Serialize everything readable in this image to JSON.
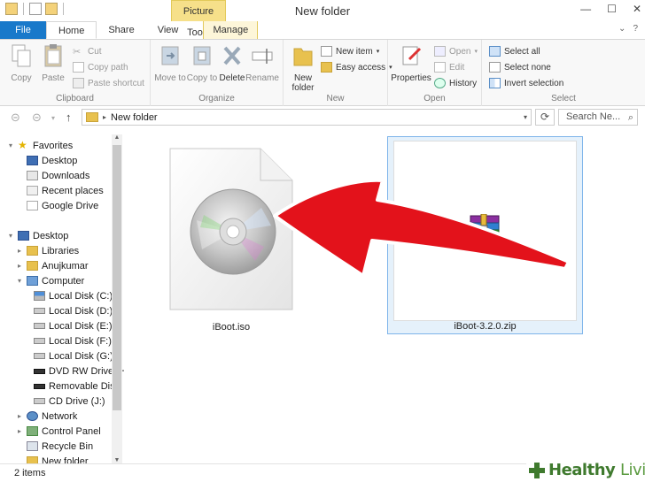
{
  "window": {
    "title": "New folder",
    "context_tab": "Picture Tools"
  },
  "tabs": [
    {
      "label": "File"
    },
    {
      "label": "Home"
    },
    {
      "label": "Share"
    },
    {
      "label": "View"
    },
    {
      "label": "Manage"
    }
  ],
  "ribbon": {
    "clipboard": {
      "label": "Clipboard",
      "copy": "Copy",
      "paste": "Paste",
      "cut": "Cut",
      "copy_path": "Copy path",
      "paste_shortcut": "Paste shortcut"
    },
    "organize": {
      "label": "Organize",
      "move_to": "Move to",
      "copy_to": "Copy to",
      "delete": "Delete",
      "rename": "Rename"
    },
    "new": {
      "label": "New",
      "new_folder": "New folder",
      "new_item": "New item",
      "easy_access": "Easy access"
    },
    "open": {
      "label": "Open",
      "properties": "Properties",
      "open": "Open",
      "edit": "Edit",
      "history": "History"
    },
    "select": {
      "label": "Select",
      "select_all": "Select all",
      "select_none": "Select none",
      "invert_selection": "Invert selection"
    }
  },
  "address": {
    "path": "New folder",
    "search_placeholder": "Search Ne..."
  },
  "nav": {
    "items": [
      {
        "label": "Favorites"
      },
      {
        "label": "Desktop"
      },
      {
        "label": "Downloads"
      },
      {
        "label": "Recent places"
      },
      {
        "label": "Google Drive"
      },
      {
        "label": "Desktop"
      },
      {
        "label": "Libraries"
      },
      {
        "label": "Anujkumar"
      },
      {
        "label": "Computer"
      },
      {
        "label": "Local Disk (C:)"
      },
      {
        "label": "Local Disk (D:)"
      },
      {
        "label": "Local Disk (E:)"
      },
      {
        "label": "Local Disk (F:)"
      },
      {
        "label": "Local Disk (G:)"
      },
      {
        "label": "DVD RW Drive (H"
      },
      {
        "label": "Removable Disk"
      },
      {
        "label": "CD Drive (J:)"
      },
      {
        "label": "Network"
      },
      {
        "label": "Control Panel"
      },
      {
        "label": "Recycle Bin"
      },
      {
        "label": "New folder"
      }
    ]
  },
  "files": [
    {
      "name": "iBoot.iso",
      "icon": "disc-image-icon"
    },
    {
      "name": "iBoot-3.2.0.zip",
      "icon": "winrar-archive-icon"
    }
  ],
  "status": {
    "count": "2 items"
  },
  "watermark": {
    "brand": "Healthy",
    "brand2": "Living"
  },
  "colors": {
    "file_tab": "#1979ca",
    "context_tab": "#f6e08a",
    "selection_border": "#7eb4ea",
    "arrow": "#e3121b",
    "watermark": "#3f7a2e"
  }
}
